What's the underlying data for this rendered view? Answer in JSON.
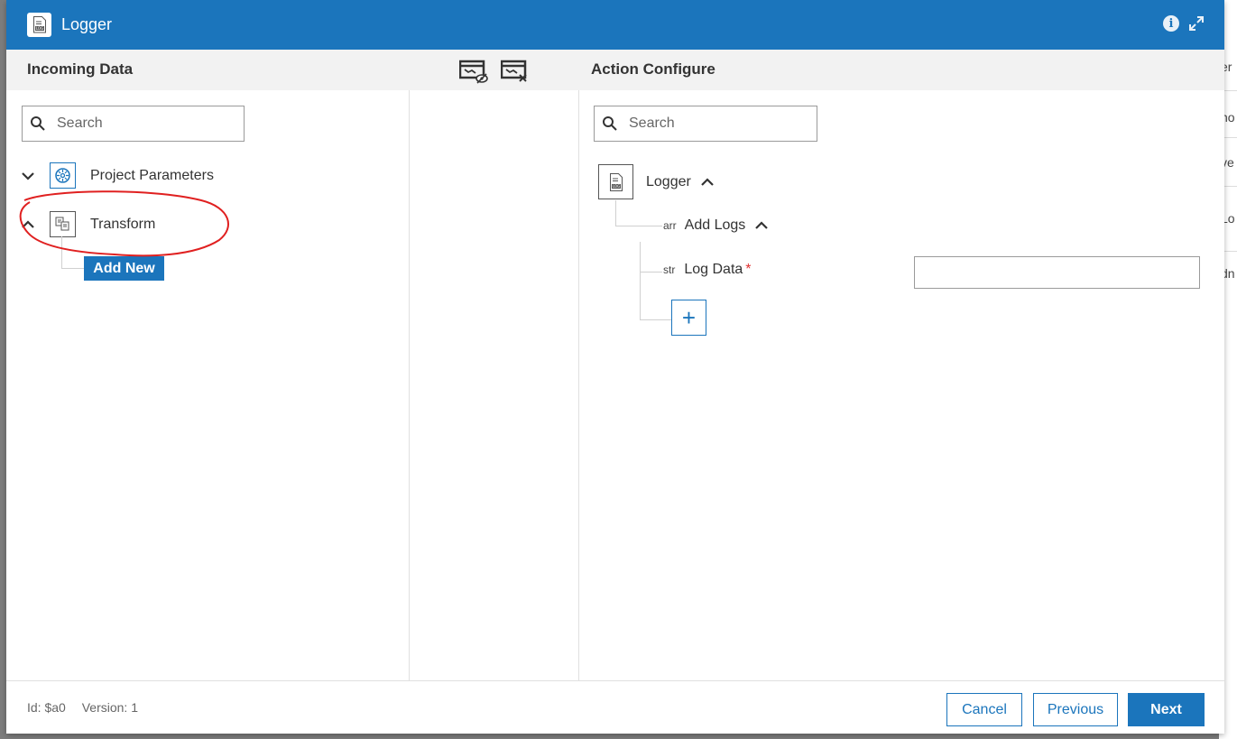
{
  "dialog": {
    "title": "Logger",
    "icons": {
      "title": "log-file-icon",
      "info": "info-icon",
      "expand": "expand-icon"
    }
  },
  "background_fragments": [
    "er",
    "no",
    "ve",
    "Lo",
    "dn"
  ],
  "left": {
    "heading": "Incoming Data",
    "search_placeholder": "Search",
    "tree": [
      {
        "label": "Project Parameters",
        "expanded": false,
        "icon": "project-parameters-icon"
      },
      {
        "label": "Transform",
        "expanded": true,
        "icon": "transform-icon"
      }
    ],
    "add_new_label": "Add New"
  },
  "toolbar": {
    "icons": [
      "hide-mapping-icon",
      "clear-mapping-icon"
    ]
  },
  "right": {
    "heading": "Action Configure",
    "search_placeholder": "Search",
    "root": {
      "label": "Logger"
    },
    "group": {
      "type": "arr",
      "label": "Add Logs"
    },
    "field": {
      "type": "str",
      "label": "Log Data",
      "required_mark": "*",
      "value": ""
    },
    "add_label": "+"
  },
  "footer": {
    "id_text": "Id: $a0",
    "version_text": "Version: 1",
    "cancel_label": "Cancel",
    "previous_label": "Previous",
    "next_label": "Next"
  },
  "colors": {
    "primary": "#1b75bc",
    "annotation": "#e02020",
    "required": "#e03030"
  }
}
